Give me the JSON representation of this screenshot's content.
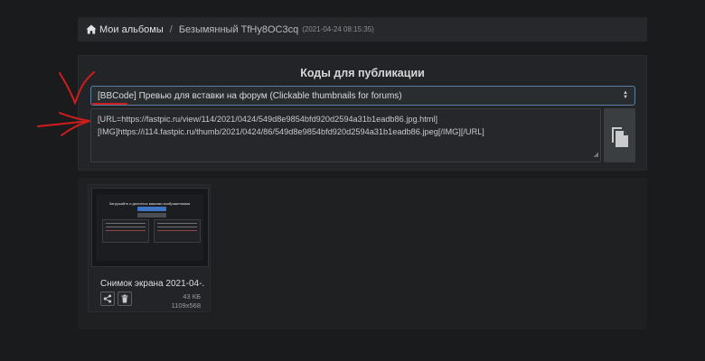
{
  "breadcrumb": {
    "home_label": "Мои альбомы",
    "separator": "/",
    "current": "Безымянный TfHy8OC3cq",
    "timestamp": "(2021-04-24 08:15:35)"
  },
  "publish": {
    "title": "Коды для публикации",
    "selected_format": "[BBCode] Превью для вставки на форум (Clickable thumbnails for forums)",
    "code_lines": [
      "[URL=https://fastpic.ru/view/114/2021/0424/549d8e9854bfd920d2594a31b1eadb86.jpg.html]",
      "[IMG]https://i114.fastpic.ru/thumb/2021/0424/86/549d8e9854bfd920d2594a31b1eadb86.jpeg[/IMG][/URL]"
    ]
  },
  "gallery": {
    "items": [
      {
        "caption": "Снимок экрана 2021-04-...",
        "size": "43 КБ",
        "dimensions": "1109x568",
        "thumb_title": "Загружайте и делитесь вашими изображениями."
      }
    ]
  },
  "colors": {
    "background": "#1a1b1d",
    "panel": "#222427",
    "annotation": "#d01c1c",
    "select_border": "#5a7fa5"
  },
  "icons": {
    "home": "home-icon",
    "copy": "copy-icon",
    "share": "share-icon",
    "delete": "trash-icon",
    "select_arrows": "sort-arrows-icon"
  }
}
